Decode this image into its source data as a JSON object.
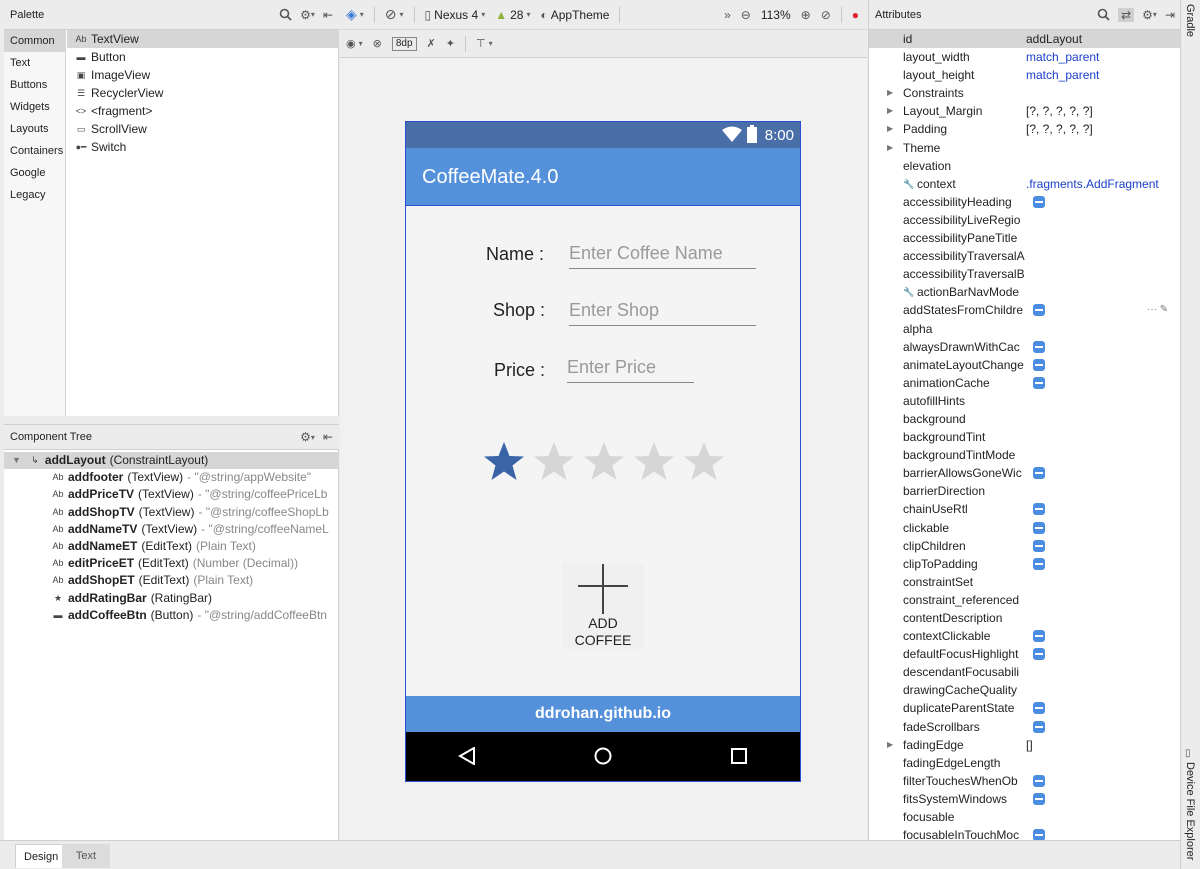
{
  "palette": {
    "title": "Palette",
    "categories": [
      "Common",
      "Text",
      "Buttons",
      "Widgets",
      "Layouts",
      "Containers",
      "Google",
      "Legacy"
    ],
    "items": [
      {
        "glyph": "Ab",
        "label": "TextView"
      },
      {
        "glyph": "▬",
        "label": "Button"
      },
      {
        "glyph": "▣",
        "label": "ImageView"
      },
      {
        "glyph": "☰",
        "label": "RecyclerView"
      },
      {
        "glyph": "<>",
        "label": "<fragment>"
      },
      {
        "glyph": "▭",
        "label": "ScrollView"
      },
      {
        "glyph": "●━",
        "label": "Switch"
      }
    ]
  },
  "tree": {
    "title": "Component Tree",
    "root": {
      "name": "addLayout",
      "type": "(ConstraintLayout)"
    },
    "rows": [
      {
        "glyph": "Ab",
        "name": "addfooter",
        "type": "(TextView)",
        "extra": "- \"@string/appWebsite\""
      },
      {
        "glyph": "Ab",
        "name": "addPriceTV",
        "type": "(TextView)",
        "extra": "- \"@string/coffeePriceLb"
      },
      {
        "glyph": "Ab",
        "name": "addShopTV",
        "type": "(TextView)",
        "extra": "- \"@string/coffeeShopLb"
      },
      {
        "glyph": "Ab",
        "name": "addNameTV",
        "type": "(TextView)",
        "extra": "- \"@string/coffeeNameL"
      },
      {
        "glyph": "Ab",
        "name": "addNameET",
        "type": "(EditText)",
        "extra": "(Plain Text)"
      },
      {
        "glyph": "Ab",
        "name": "editPriceET",
        "type": "(EditText)",
        "extra": "(Number (Decimal))"
      },
      {
        "glyph": "Ab",
        "name": "addShopET",
        "type": "(EditText)",
        "extra": "(Plain Text)"
      },
      {
        "glyph": "★",
        "name": "addRatingBar",
        "type": "(RatingBar)",
        "extra": ""
      },
      {
        "glyph": "▬",
        "name": "addCoffeeBtn",
        "type": "(Button)",
        "extra": "- \"@string/addCoffeeBtn"
      }
    ]
  },
  "toolbar": {
    "device": "Nexus 4",
    "api": "28",
    "theme": "AppTheme",
    "zoom": "113%",
    "margin": "8dp"
  },
  "device": {
    "time": "8:00",
    "app_title": "CoffeeMate.4.0",
    "name_label": "Name :",
    "name_hint": "Enter Coffee Name",
    "shop_label": "Shop :",
    "shop_hint": "Enter Shop",
    "price_label": "Price :",
    "price_hint": "Enter Price",
    "rating": 1,
    "rating_max": 5,
    "add_button_line1": "ADD",
    "add_button_line2": "COFFEE",
    "footer": "ddrohan.github.io",
    "colors": {
      "appbar": "#5590db",
      "statusbar": "#4a6ea8",
      "star_filled": "#3a64a8",
      "star_empty": "#d6d6d6"
    }
  },
  "attributes": {
    "title": "Attributes",
    "rows": [
      {
        "name": "id",
        "value": "addLayout",
        "sel": true
      },
      {
        "name": "layout_width",
        "value": "match_parent",
        "blue": true
      },
      {
        "name": "layout_height",
        "value": "match_parent",
        "blue": true
      },
      {
        "name": "Constraints",
        "value": "",
        "expand": true
      },
      {
        "name": "Layout_Margin",
        "value": "[?, ?, ?, ?, ?]",
        "expand": true
      },
      {
        "name": "Padding",
        "value": "[?, ?, ?, ?, ?]",
        "expand": true
      },
      {
        "name": "Theme",
        "value": "",
        "expand": true
      },
      {
        "name": "elevation",
        "value": ""
      },
      {
        "name": "context",
        "value": ".fragments.AddFragment",
        "blue": true,
        "wrench": true
      },
      {
        "name": "accessibilityHeading",
        "value": "",
        "flag": true
      },
      {
        "name": "accessibilityLiveRegio",
        "value": ""
      },
      {
        "name": "accessibilityPaneTitle",
        "value": ""
      },
      {
        "name": "accessibilityTraversalA",
        "value": ""
      },
      {
        "name": "accessibilityTraversalB",
        "value": ""
      },
      {
        "name": "actionBarNavMode",
        "value": "",
        "wrench": true
      },
      {
        "name": "addStatesFromChildre",
        "value": "",
        "flag": true,
        "more": true
      },
      {
        "name": "alpha",
        "value": ""
      },
      {
        "name": "alwaysDrawnWithCac",
        "value": "",
        "flag": true
      },
      {
        "name": "animateLayoutChange",
        "value": "",
        "flag": true
      },
      {
        "name": "animationCache",
        "value": "",
        "flag": true
      },
      {
        "name": "autofillHints",
        "value": ""
      },
      {
        "name": "background",
        "value": ""
      },
      {
        "name": "backgroundTint",
        "value": ""
      },
      {
        "name": "backgroundTintMode",
        "value": ""
      },
      {
        "name": "barrierAllowsGoneWic",
        "value": "",
        "flag": true
      },
      {
        "name": "barrierDirection",
        "value": ""
      },
      {
        "name": "chainUseRtl",
        "value": "",
        "flag": true
      },
      {
        "name": "clickable",
        "value": "",
        "flag": true
      },
      {
        "name": "clipChildren",
        "value": "",
        "flag": true
      },
      {
        "name": "clipToPadding",
        "value": "",
        "flag": true
      },
      {
        "name": "constraintSet",
        "value": ""
      },
      {
        "name": "constraint_referenced",
        "value": ""
      },
      {
        "name": "contentDescription",
        "value": ""
      },
      {
        "name": "contextClickable",
        "value": "",
        "flag": true
      },
      {
        "name": "defaultFocusHighlight",
        "value": "",
        "flag": true
      },
      {
        "name": "descendantFocusabili",
        "value": ""
      },
      {
        "name": "drawingCacheQuality",
        "value": ""
      },
      {
        "name": "duplicateParentState",
        "value": "",
        "flag": true
      },
      {
        "name": "fadeScrollbars",
        "value": "",
        "flag": true
      },
      {
        "name": "fadingEdge",
        "value": "[]",
        "expand": true
      },
      {
        "name": "fadingEdgeLength",
        "value": ""
      },
      {
        "name": "filterTouchesWhenOb",
        "value": "",
        "flag": true
      },
      {
        "name": "fitsSystemWindows",
        "value": "",
        "flag": true
      },
      {
        "name": "focusable",
        "value": ""
      },
      {
        "name": "focusableInTouchMoc",
        "value": "",
        "flag": true
      }
    ]
  },
  "side": {
    "gradle": "Gradle",
    "device_file_explorer": "Device File Explorer"
  },
  "bottom_tabs": [
    "Design",
    "Text"
  ]
}
